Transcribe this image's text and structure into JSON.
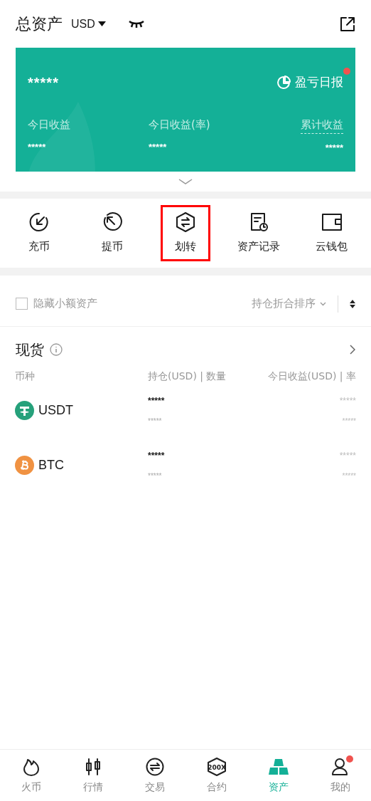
{
  "header": {
    "title": "总资产",
    "currency": "USD",
    "hidden": true
  },
  "summary_card": {
    "total": "*****",
    "report": {
      "label": "盈亏日报",
      "unread": true
    },
    "stats": [
      {
        "label": "今日收益",
        "value": "*****",
        "dashed": false
      },
      {
        "label": "今日收益(率)",
        "value": "*****",
        "dashed": false
      },
      {
        "label": "累计收益",
        "value": "*****",
        "dashed": true
      }
    ]
  },
  "actions": [
    {
      "kind": "deposit",
      "label": "充币",
      "highlighted": false
    },
    {
      "kind": "withdraw",
      "label": "提币",
      "highlighted": false
    },
    {
      "kind": "transfer",
      "label": "划转",
      "highlighted": true
    },
    {
      "kind": "records",
      "label": "资产记录",
      "highlighted": false
    },
    {
      "kind": "wallet",
      "label": "云钱包",
      "highlighted": false
    }
  ],
  "filter": {
    "hide_small": {
      "label": "隐藏小额资产",
      "checked": false
    },
    "sort": "持仓折合排序"
  },
  "section": {
    "title": "现货",
    "columns": [
      "币种",
      "持仓(USD) | 数量",
      "今日收益(USD) | 率"
    ],
    "rows": [
      {
        "coin": "USDT",
        "kind": "usdt",
        "holding": "*****",
        "amount": "*****",
        "profit": "*****",
        "rate": "*****"
      },
      {
        "coin": "BTC",
        "kind": "btc",
        "holding": "*****",
        "amount": "*****",
        "profit": "*****",
        "rate": "*****"
      }
    ]
  },
  "tabbar": [
    {
      "kind": "flame",
      "label": "火币",
      "selected": false,
      "dot": false
    },
    {
      "kind": "candles",
      "label": "行情",
      "selected": false,
      "dot": false
    },
    {
      "kind": "exchange",
      "label": "交易",
      "selected": false,
      "dot": false
    },
    {
      "kind": "contract",
      "label": "合约",
      "selected": false,
      "dot": false,
      "icon_text": "200X"
    },
    {
      "kind": "assets",
      "label": "资产",
      "selected": true,
      "dot": false
    },
    {
      "kind": "profile",
      "label": "我的",
      "selected": false,
      "dot": true
    }
  ]
}
